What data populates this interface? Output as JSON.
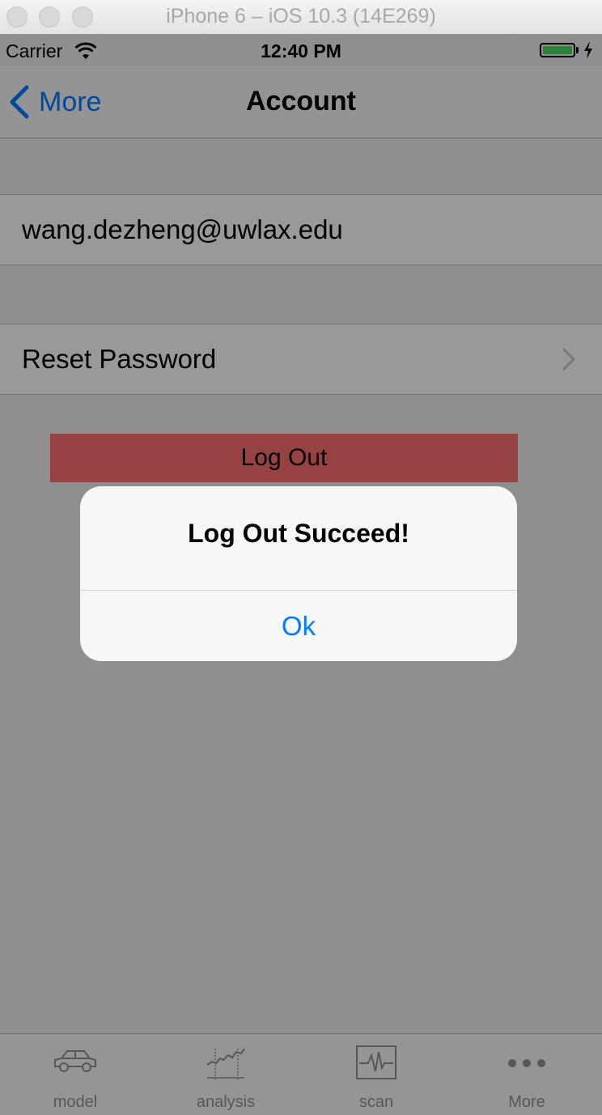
{
  "window": {
    "title": "iPhone 6 – iOS 10.3 (14E269)"
  },
  "status_bar": {
    "carrier": "Carrier",
    "time": "12:40 PM",
    "battery_color": "#4cd964"
  },
  "nav_bar": {
    "back_label": "More",
    "title": "Account"
  },
  "account": {
    "email": "wang.dezheng@uwlax.edu",
    "reset_password_label": "Reset Password",
    "logout_label": "Log Out",
    "logout_color": "#fc6f6f"
  },
  "alert": {
    "title": "Log Out Succeed!",
    "ok_label": "Ok"
  },
  "tab_bar": {
    "tabs": [
      {
        "label": "model",
        "icon": "car-icon"
      },
      {
        "label": "analysis",
        "icon": "chart-icon"
      },
      {
        "label": "scan",
        "icon": "pulse-icon"
      },
      {
        "label": "More",
        "icon": "more-dots-icon"
      }
    ]
  },
  "colors": {
    "accent": "#007aff",
    "overlay": "rgba(0,0,0,0.40)"
  }
}
